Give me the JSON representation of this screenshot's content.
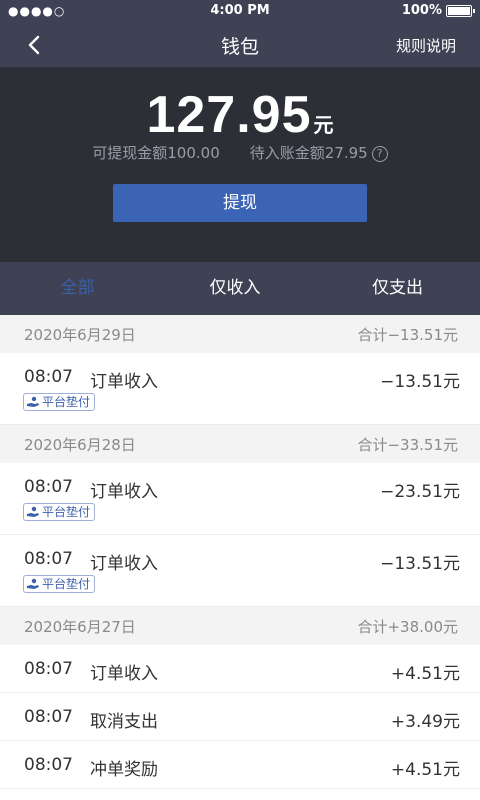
{
  "status_bar": {
    "signal": "●●●●○",
    "time": "4:00 PM",
    "battery": "100%"
  },
  "nav": {
    "title": "钱包",
    "rules_label": "规则说明",
    "back_icon": "chevron-left-icon"
  },
  "balance": {
    "amount": "127.95",
    "unit": "元",
    "withdrawable": "可提现金额100.00",
    "pending": "待入账金额27.95",
    "help_icon": "question-circle-icon",
    "withdraw_label": "提现"
  },
  "tabs": [
    {
      "label": "全部",
      "active": true
    },
    {
      "label": "仅收入",
      "active": false
    },
    {
      "label": "仅支出",
      "active": false
    }
  ],
  "groups": [
    {
      "date": "2020年6月29日",
      "total": "合计−13.51元",
      "items": [
        {
          "time": "08:07",
          "title": "订单收入",
          "amount": "−13.51元",
          "tag": "平台垫付"
        }
      ]
    },
    {
      "date": "2020年6月28日",
      "total": "合计−33.51元",
      "items": [
        {
          "time": "08:07",
          "title": "订单收入",
          "amount": "−23.51元",
          "tag": "平台垫付"
        },
        {
          "time": "08:07",
          "title": "订单收入",
          "amount": "−13.51元",
          "tag": "平台垫付"
        }
      ]
    },
    {
      "date": "2020年6月27日",
      "total": "合计+38.00元",
      "items": [
        {
          "time": "08:07",
          "title": "订单收入",
          "amount": "+4.51元",
          "tag": ""
        },
        {
          "time": "08:07",
          "title": "取消支出",
          "amount": "+3.49元",
          "tag": ""
        },
        {
          "time": "08:07",
          "title": "冲单奖励",
          "amount": "+4.51元",
          "tag": ""
        }
      ]
    }
  ],
  "colors": {
    "header_bg": "#3f4254",
    "balance_bg": "#2d2f37",
    "accent": "#3b63b6",
    "active_tab": "#3b5fa8"
  }
}
